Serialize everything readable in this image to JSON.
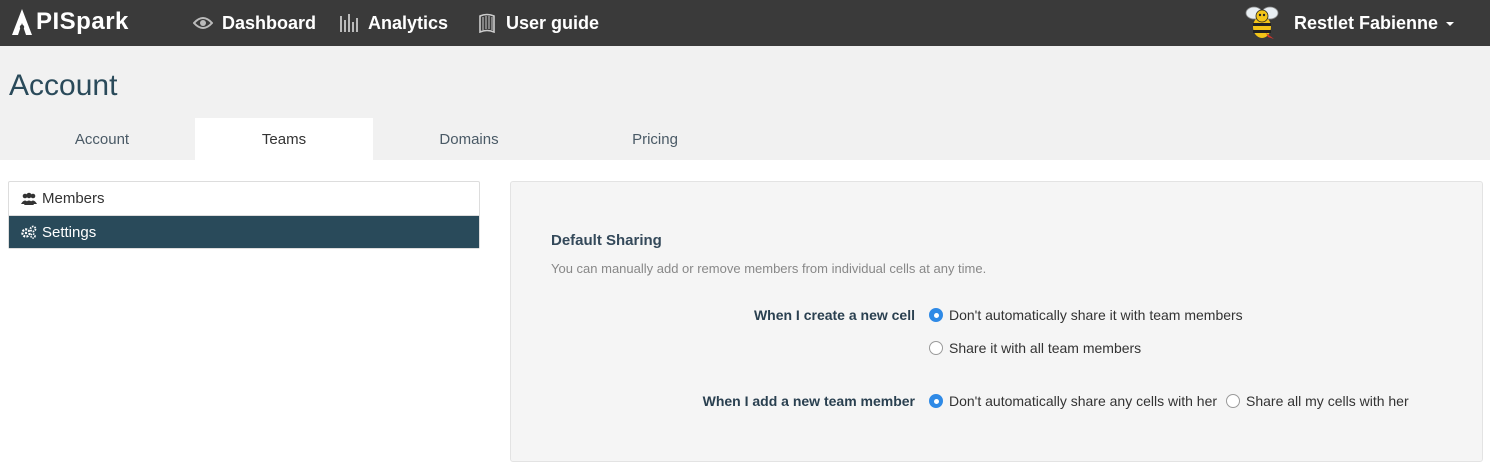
{
  "app": {
    "logo_text": "PISpark",
    "logo_letter": "A"
  },
  "navbar": {
    "dashboard_label": "Dashboard",
    "analytics_label": "Analytics",
    "guide_label": "User guide",
    "user_name": "Restlet Fabienne",
    "icons": [
      "eye-icon",
      "bars-icon",
      "book-icon",
      "bee-avatar"
    ]
  },
  "page": {
    "title": "Account"
  },
  "tabs": [
    {
      "label": "Account",
      "active": false
    },
    {
      "label": "Teams",
      "active": true
    },
    {
      "label": "Domains",
      "active": false
    },
    {
      "label": "Pricing",
      "active": false
    }
  ],
  "sidebar": {
    "items": [
      {
        "label": "Members",
        "icon": "users-icon",
        "active": false
      },
      {
        "label": "Settings",
        "icon": "gears-icon",
        "active": true
      }
    ]
  },
  "settings": {
    "section_title": "Default Sharing",
    "section_help": "You can manually add or remove members from individual cells at any time.",
    "new_cell": {
      "label": "When I create a new cell",
      "options": [
        {
          "label": "Don't automatically share it with team members",
          "checked": true
        },
        {
          "label": "Share it with all team members",
          "checked": false
        }
      ]
    },
    "new_member": {
      "label": "When I add a new team member",
      "options": [
        {
          "label": "Don't automatically share any cells with her",
          "checked": true
        },
        {
          "label": "Share all my cells with her",
          "checked": false
        }
      ]
    }
  },
  "colors": {
    "navbar_bg": "#3a3a3a",
    "active_sidebar_bg": "#294a5a",
    "radio_checked": "#2f8ae6",
    "title_color": "#2a4a5a"
  }
}
